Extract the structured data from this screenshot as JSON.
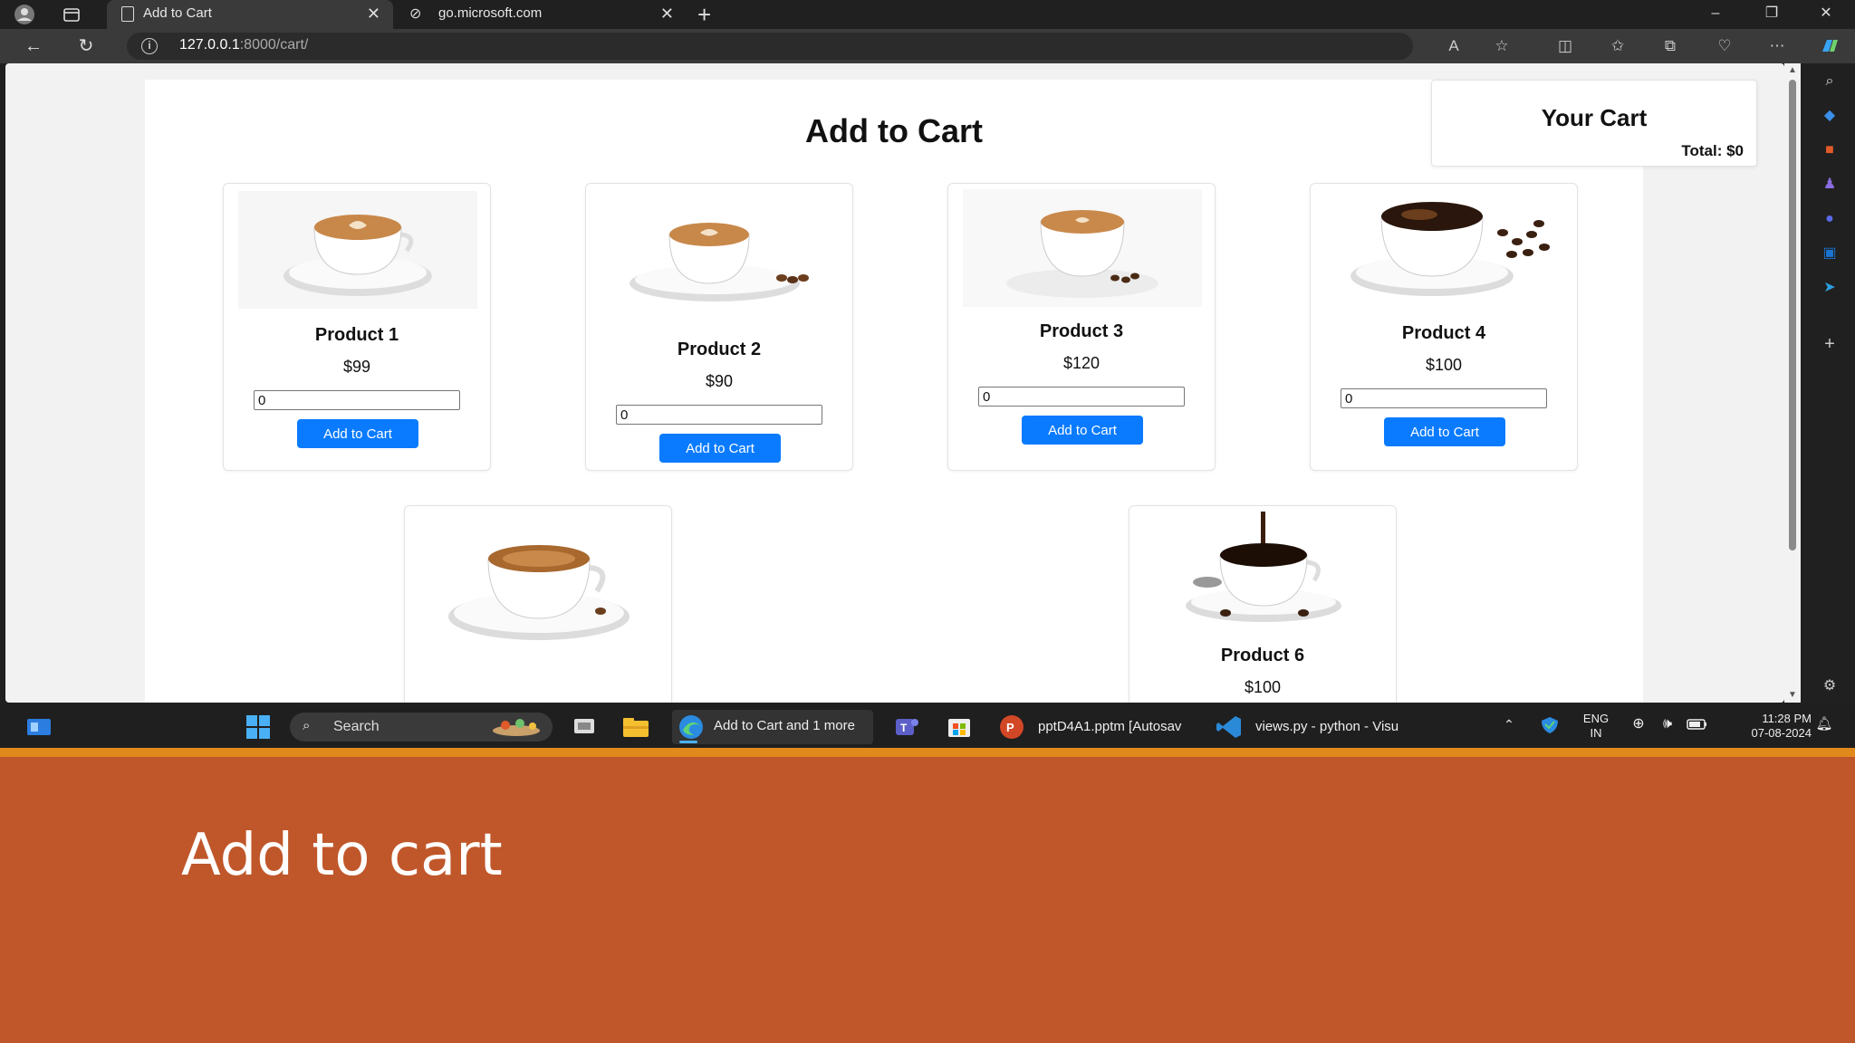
{
  "browser": {
    "tabs": [
      {
        "title": "Add to Cart",
        "active": true
      },
      {
        "title": "go.microsoft.com",
        "active": false
      }
    ],
    "address": {
      "host": "127.0.0.1",
      "rest": ":8000/cart/"
    }
  },
  "page": {
    "heading": "Add to Cart",
    "cart": {
      "title": "Your Cart",
      "total": "Total: $0"
    },
    "products": [
      {
        "name": "Product 1",
        "price": "$99",
        "qty": "0",
        "button": "Add to Cart"
      },
      {
        "name": "Product 2",
        "price": "$90",
        "qty": "0",
        "button": "Add to Cart"
      },
      {
        "name": "Product 3",
        "price": "$120",
        "qty": "0",
        "button": "Add to Cart"
      },
      {
        "name": "Product 4",
        "price": "$100",
        "qty": "0",
        "button": "Add to Cart"
      },
      {
        "name": "",
        "price": "",
        "qty": "",
        "button": ""
      },
      {
        "name": "Product 6",
        "price": "$100",
        "qty": "",
        "button": ""
      }
    ]
  },
  "taskbar": {
    "search": "Search",
    "edge_label": "Add to Cart and 1 more",
    "ppt_label": "pptD4A1.pptm [Autosav",
    "vscode_label": "views.py - python - Visu",
    "lang_top": "ENG",
    "lang_bottom": "IN",
    "time": "11:28 PM",
    "date": "07-08-2024"
  },
  "slide": {
    "caption": "Add to cart"
  },
  "colors": {
    "accent_button": "#0a7bff",
    "slide_background": "#c0572a",
    "taskbar_accent": "#e08a1e"
  }
}
